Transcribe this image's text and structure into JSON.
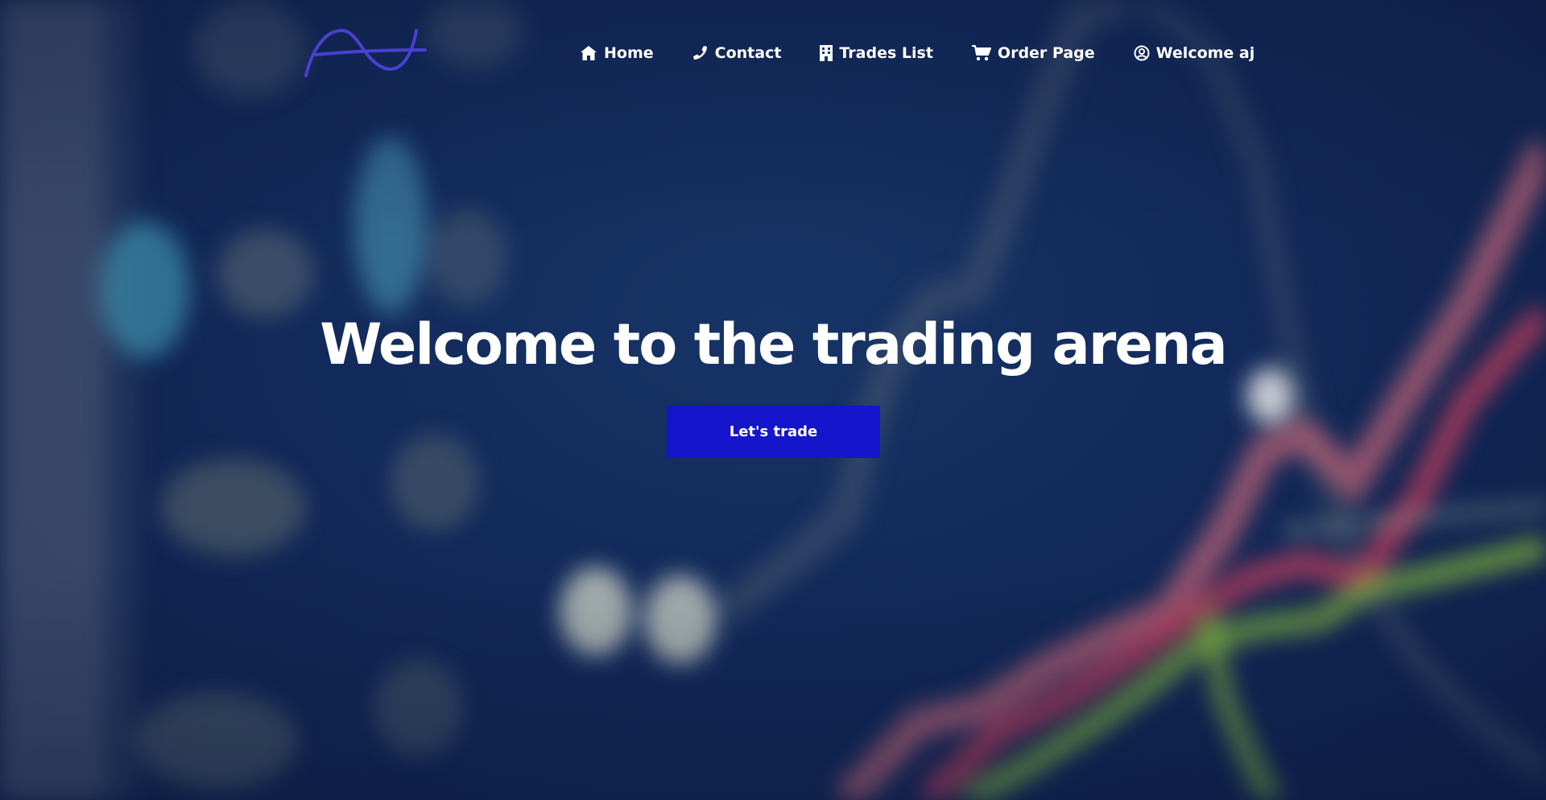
{
  "navbar": {
    "logo_icon": "wave-logo",
    "items": [
      {
        "label": "Home",
        "icon": "home-icon"
      },
      {
        "label": "Contact",
        "icon": "phone-icon"
      },
      {
        "label": "Trades List",
        "icon": "building-icon"
      },
      {
        "label": "Order Page",
        "icon": "cart-icon"
      },
      {
        "label": "Welcome aj",
        "icon": "user-circle-icon"
      }
    ]
  },
  "hero": {
    "title": "Welcome to the trading arena",
    "cta_label": "Let's trade"
  },
  "colors": {
    "background": "#12295a",
    "accent": "#1515cc",
    "logo": "#4b3fd1",
    "text": "#ffffff"
  }
}
